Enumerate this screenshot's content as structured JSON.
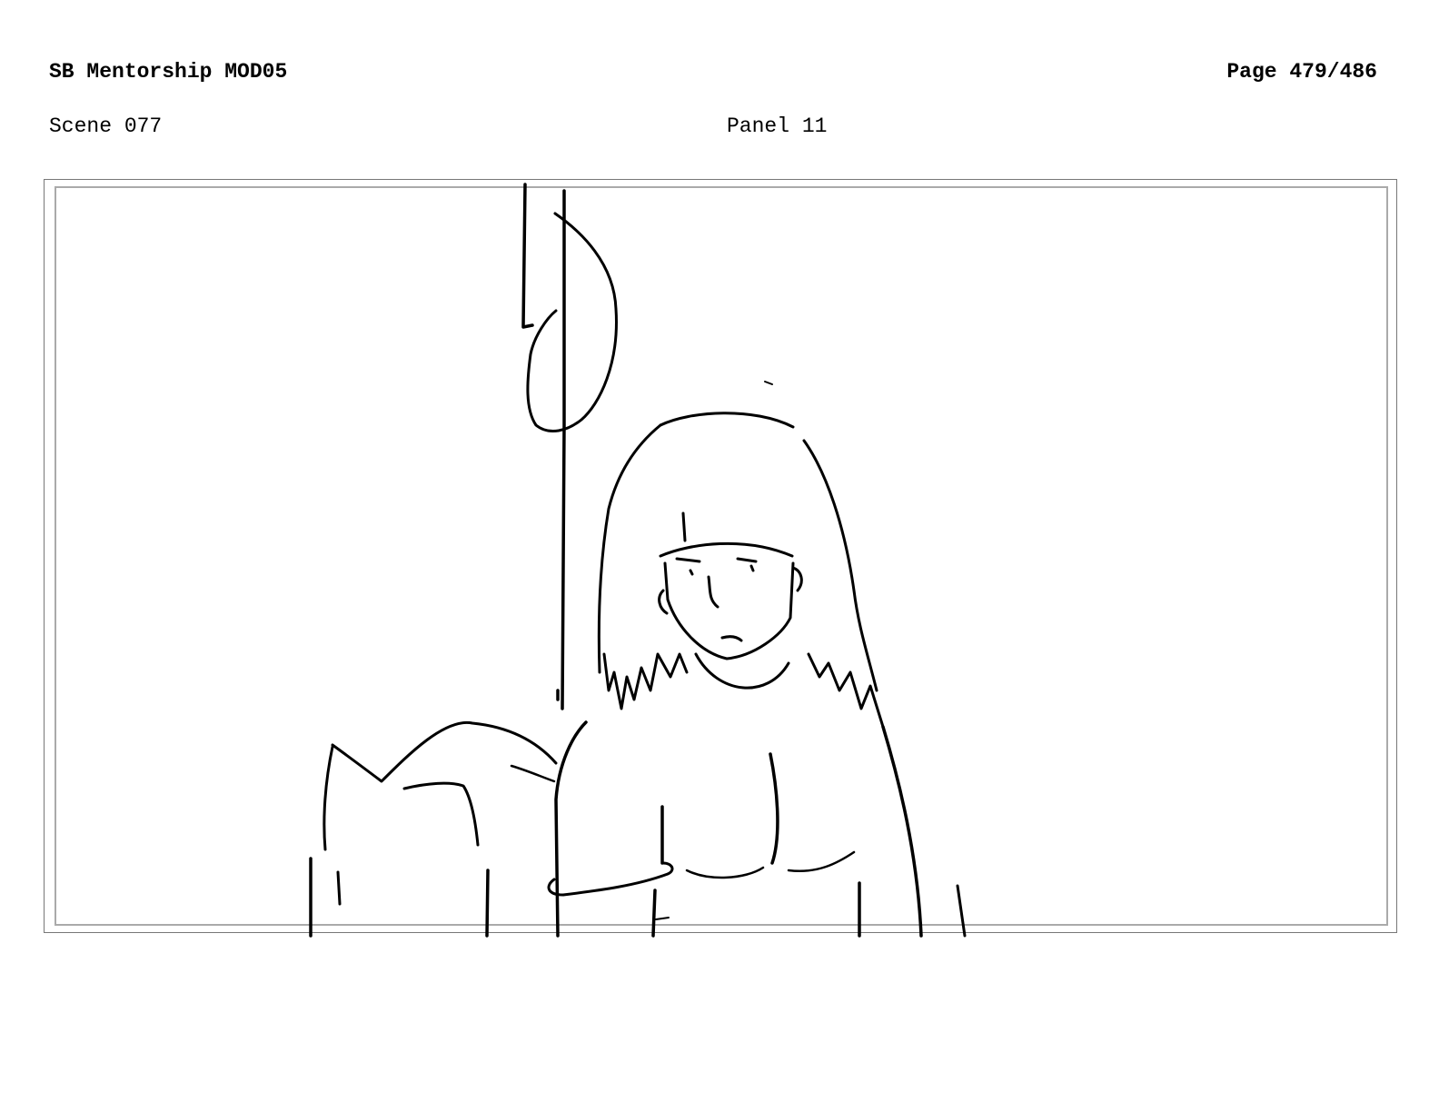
{
  "header": {
    "title": "SB Mentorship MOD05",
    "page": "Page 479/486"
  },
  "panel_info": {
    "scene": "Scene 077",
    "panel": "Panel 11"
  }
}
